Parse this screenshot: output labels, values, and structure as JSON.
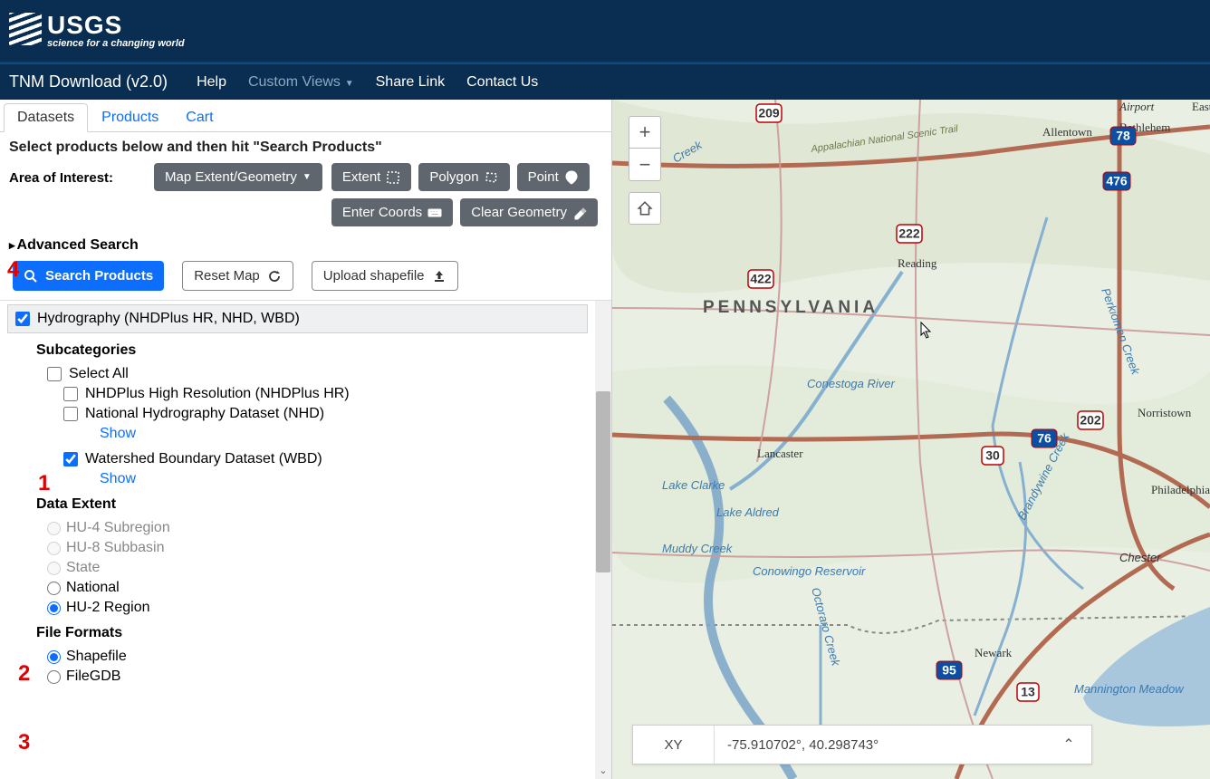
{
  "logo": {
    "big": "USGS",
    "tag": "science for a changing world"
  },
  "app_title": "TNM Download (v2.0)",
  "nav": {
    "help": "Help",
    "custom": "Custom Views",
    "share": "Share Link",
    "contact": "Contact Us"
  },
  "tabs": {
    "datasets": "Datasets",
    "products": "Products",
    "cart": "Cart"
  },
  "instruction": "Select products below and then hit \"Search Products\"",
  "aoi_label": "Area of Interest:",
  "aoi": {
    "map_extent": "Map Extent/Geometry",
    "extent": "Extent",
    "polygon": "Polygon",
    "point": "Point",
    "enter_coords": "Enter Coords",
    "clear_geom": "Clear Geometry"
  },
  "advanced": "Advanced Search",
  "actions": {
    "search": "Search Products",
    "reset": "Reset Map",
    "upload": "Upload shapefile"
  },
  "dataset": {
    "head": "Hydrography (NHDPlus HR, NHD, WBD)",
    "sub_h": "Subcategories",
    "select_all": "Select All",
    "nhdplus": "NHDPlus High Resolution (NHDPlus HR)",
    "nhd": "National Hydrography Dataset (NHD)",
    "wbd": "Watershed Boundary Dataset (WBD)",
    "show": "Show",
    "extent_h": "Data Extent",
    "hu4": "HU-4 Subregion",
    "hu8": "HU-8 Subbasin",
    "state": "State",
    "national": "National",
    "hu2": "HU-2 Region",
    "format_h": "File Formats",
    "shp": "Shapefile",
    "gdb": "FileGDB"
  },
  "coords": {
    "label": "XY",
    "value": "-75.910702°, 40.298743°"
  },
  "map": {
    "state": "PENNSYLVANIA",
    "cities": {
      "reading": "Reading",
      "lancaster": "Lancaster",
      "bethlehem": "Bethlehem",
      "allentown": "Allentown",
      "norristown": "Norristown",
      "philadelphia": "Philadelphia",
      "chester": "Chester",
      "newark": "Newark",
      "easton": "Easton",
      "airport": "Airport"
    },
    "water": {
      "conestoga": "Conestoga River",
      "clarke": "Lake Clarke",
      "aldred": "Lake Aldred",
      "muddy": "Muddy Creek",
      "conowingo": "Conowingo Reservoir",
      "mannington": "Mannington Meadow",
      "brandywine": "Brandywine Creek",
      "perkiomen": "Perkiomen Creek",
      "octoraro": "Octoraro Creek",
      "creek": "Creek"
    },
    "trail": "Appalachian National Scenic Trail",
    "shields": {
      "i76": "76",
      "i78": "78",
      "i476": "476",
      "i95": "95",
      "us30": "30",
      "us222": "222",
      "us202": "202",
      "us422": "422",
      "us209": "209",
      "r13": "13"
    }
  },
  "annot": {
    "n1": "1",
    "n2": "2",
    "n3": "3",
    "n4": "4"
  }
}
